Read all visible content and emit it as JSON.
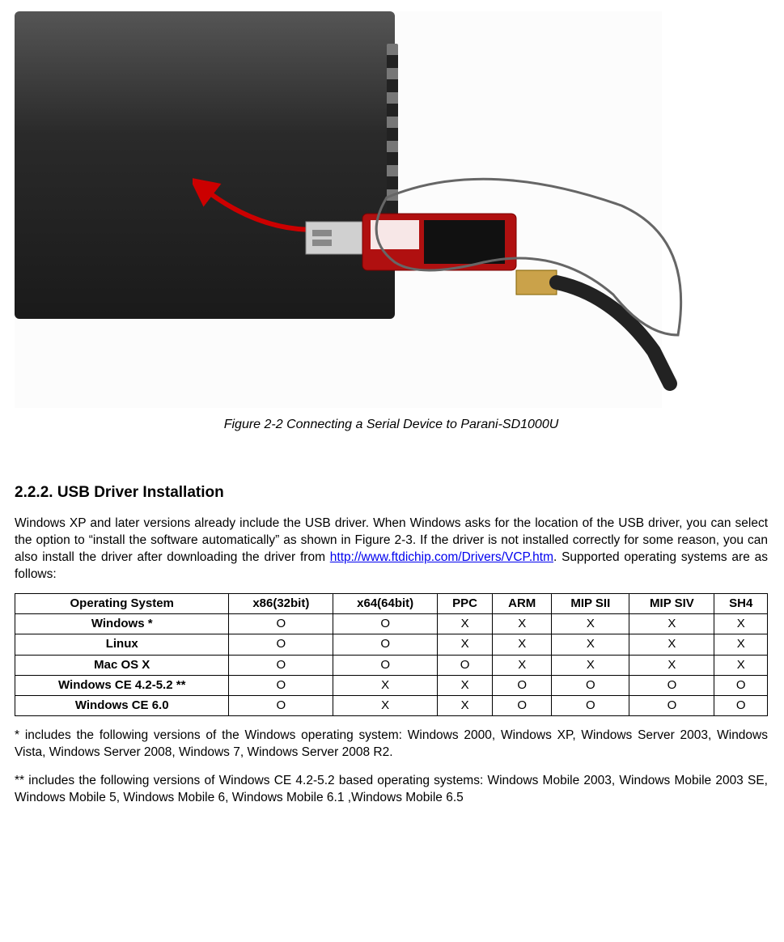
{
  "figure_caption": "Figure 2-2 Connecting a Serial Device to Parani-SD1000U",
  "section_heading": "2.2.2. USB Driver Installation",
  "intro_pre": "Windows XP and later versions already include the USB driver. When Windows asks for the location of the USB driver, you can select the option to “install the software automatically” as shown in Figure 2-3. If the driver is not installed correctly for some reason, you can also install the driver after downloading the driver from ",
  "intro_link_text": "http://www.ftdichip.com/Drivers/VCP.htm",
  "intro_post": ". Supported operating systems are as follows:",
  "table": {
    "headers": [
      "Operating System",
      "x86(32bit)",
      "x64(64bit)",
      "PPC",
      "ARM",
      "MIP SII",
      "MIP SIV",
      "SH4"
    ],
    "rows": [
      {
        "os": "Windows *",
        "cells": [
          "O",
          "O",
          "X",
          "X",
          "X",
          "X",
          "X"
        ]
      },
      {
        "os": "Linux",
        "cells": [
          "O",
          "O",
          "X",
          "X",
          "X",
          "X",
          "X"
        ]
      },
      {
        "os": "Mac OS X",
        "cells": [
          "O",
          "O",
          "O",
          "X",
          "X",
          "X",
          "X"
        ]
      },
      {
        "os": "Windows CE 4.2-5.2 **",
        "cells": [
          "O",
          "X",
          "X",
          "O",
          "O",
          "O",
          "O"
        ]
      },
      {
        "os": "Windows CE 6.0",
        "cells": [
          "O",
          "X",
          "X",
          "O",
          "O",
          "O",
          "O"
        ]
      }
    ]
  },
  "note1": "* includes the following versions of the Windows operating system: Windows 2000, Windows XP, Windows Server 2003, Windows Vista, Windows Server 2008, Windows 7, Windows Server 2008 R2.",
  "note2": "** includes the following versions of Windows CE 4.2-5.2 based operating systems: Windows Mobile 2003, Windows Mobile 2003 SE, Windows Mobile 5, Windows Mobile 6, Windows Mobile 6.1 ,Windows Mobile 6.5"
}
